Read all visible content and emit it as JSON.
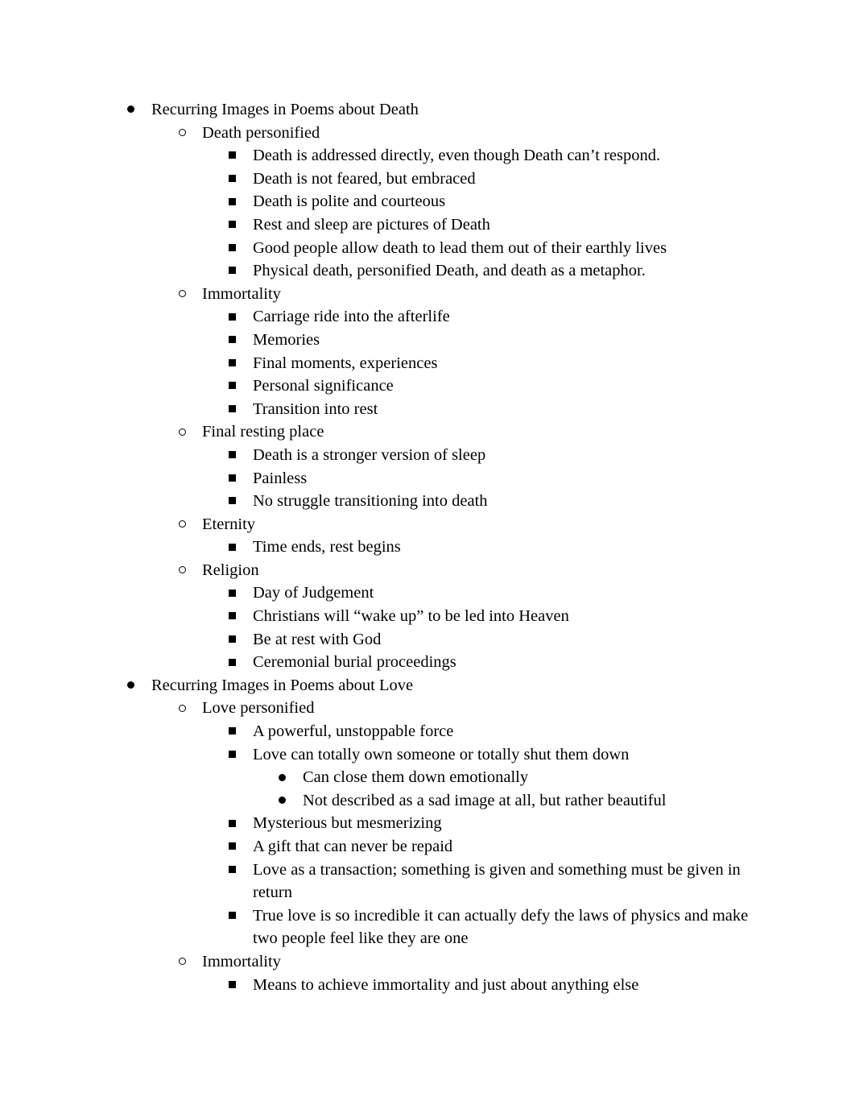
{
  "outline": [
    {
      "level": 1,
      "bullet": "filled-circle",
      "text": "Recurring Images in Poems about Death"
    },
    {
      "level": 2,
      "bullet": "hollow-circle",
      "text": "Death personified"
    },
    {
      "level": 3,
      "bullet": "square",
      "text": "Death is addressed directly, even though Death can’t respond."
    },
    {
      "level": 3,
      "bullet": "square",
      "text": "Death is not feared, but embraced"
    },
    {
      "level": 3,
      "bullet": "square",
      "text": "Death is polite and courteous"
    },
    {
      "level": 3,
      "bullet": "square",
      "text": "Rest and sleep are pictures of Death"
    },
    {
      "level": 3,
      "bullet": "square",
      "text": "Good people allow death to lead them out of their earthly lives"
    },
    {
      "level": 3,
      "bullet": "square",
      "text": "Physical death, personified Death, and death as a metaphor."
    },
    {
      "level": 2,
      "bullet": "hollow-circle",
      "text": "Immortality"
    },
    {
      "level": 3,
      "bullet": "square",
      "text": "Carriage ride into the afterlife"
    },
    {
      "level": 3,
      "bullet": "square",
      "text": "Memories"
    },
    {
      "level": 3,
      "bullet": "square",
      "text": "Final moments, experiences"
    },
    {
      "level": 3,
      "bullet": "square",
      "text": "Personal significance"
    },
    {
      "level": 3,
      "bullet": "square",
      "text": "Transition into rest"
    },
    {
      "level": 2,
      "bullet": "hollow-circle",
      "text": "Final resting place"
    },
    {
      "level": 3,
      "bullet": "square",
      "text": "Death is a stronger version of sleep"
    },
    {
      "level": 3,
      "bullet": "square",
      "text": "Painless"
    },
    {
      "level": 3,
      "bullet": "square",
      "text": "No struggle transitioning into death"
    },
    {
      "level": 2,
      "bullet": "hollow-circle",
      "text": "Eternity"
    },
    {
      "level": 3,
      "bullet": "square",
      "text": "Time ends, rest begins"
    },
    {
      "level": 2,
      "bullet": "hollow-circle",
      "text": "Religion"
    },
    {
      "level": 3,
      "bullet": "square",
      "text": "Day of Judgement"
    },
    {
      "level": 3,
      "bullet": "square",
      "text": "Christians will “wake up” to be led into Heaven"
    },
    {
      "level": 3,
      "bullet": "square",
      "text": "Be at rest with God"
    },
    {
      "level": 3,
      "bullet": "square",
      "text": "Ceremonial burial proceedings"
    },
    {
      "level": 1,
      "bullet": "filled-circle",
      "text": "Recurring Images in Poems about Love"
    },
    {
      "level": 2,
      "bullet": "hollow-circle",
      "text": "Love personified"
    },
    {
      "level": 3,
      "bullet": "square",
      "text": "A powerful, unstoppable force"
    },
    {
      "level": 3,
      "bullet": "square",
      "text": "Love can totally own someone or totally shut them down"
    },
    {
      "level": 4,
      "bullet": "filled-circle",
      "text": "Can close them down emotionally"
    },
    {
      "level": 4,
      "bullet": "filled-circle",
      "text": "Not described as a sad image at all, but rather beautiful"
    },
    {
      "level": 3,
      "bullet": "square",
      "text": "Mysterious but mesmerizing"
    },
    {
      "level": 3,
      "bullet": "square",
      "text": "A gift that can never be repaid"
    },
    {
      "level": 3,
      "bullet": "square",
      "text": "Love as a transaction; something is given and something must be given in return"
    },
    {
      "level": 3,
      "bullet": "square",
      "text": "True love is so incredible it can actually defy the laws of physics and make two people feel like they are one"
    },
    {
      "level": 2,
      "bullet": "hollow-circle",
      "text": "Immortality"
    },
    {
      "level": 3,
      "bullet": "square",
      "text": "Means to achieve immortality and just about anything else"
    }
  ]
}
